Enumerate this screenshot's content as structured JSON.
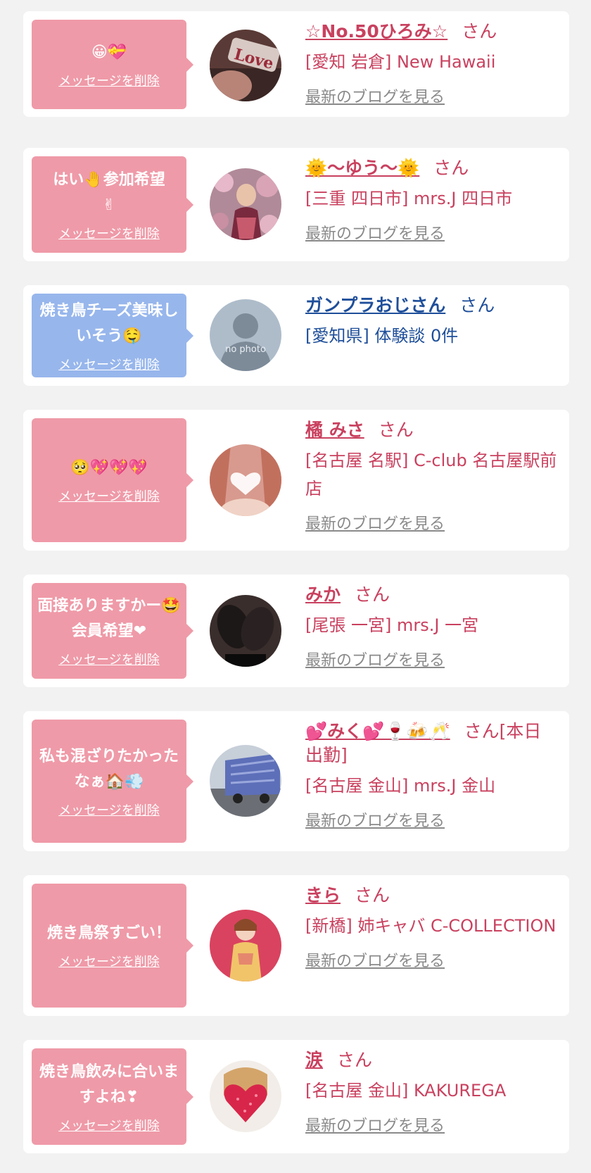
{
  "colors": {
    "card_bg": "#ffffff",
    "page_bg": "#f2f2f2",
    "bubble_pink": "#ef9aa8",
    "bubble_blue": "#97b6ec",
    "text_pink": "#c9415f",
    "text_blue": "#1f4f9a",
    "link_gray": "#8a8a8a"
  },
  "delete_label": "メッセージを削除",
  "blog_label": "最新のブログを見る",
  "san_suffix": "さん",
  "messages": [
    {
      "message": "😀💝",
      "name": "☆No.50ひろみ☆",
      "shop": "[愛知 岩倉] New Hawaii",
      "avatar": "photo-love-sign",
      "show_blog": true
    },
    {
      "message": "はい🤚参加希望\n✌",
      "name": "🌞〜ゆう〜🌞",
      "shop": "[三重 四日市] mrs.J 四日市",
      "avatar": "photo-kimono-flowers",
      "show_blog": true
    },
    {
      "message": "焼き鳥チーズ美味しいそう🤤",
      "name": "ガンプラおじさん",
      "shop": "[愛知県] 体験談 0件",
      "avatar": "no-photo-silhouette",
      "no_photo_text": "no photo",
      "show_blog": false
    },
    {
      "message": "🥺💖💖💖",
      "name": "橘 みさ",
      "shop": "[名古屋 名駅] C-club 名古屋駅前店",
      "avatar": "photo-heart-face",
      "show_blog": true
    },
    {
      "message": "面接ありますかー🤩会員希望❤",
      "name": "みか",
      "shop": "[尾張 一宮] mrs.J 一宮",
      "avatar": "photo-stockings",
      "show_blog": true
    },
    {
      "message": "私も混ざりたかったなぁ🏠💨",
      "name": "💕みく💕🍷🍻🥂",
      "name_suffix": "さん[本日出勤]",
      "shop": "[名古屋 金山] mrs.J 金山",
      "avatar": "photo-truck",
      "show_blog": true
    },
    {
      "message": "焼き鳥祭すごい！",
      "name": "きら",
      "shop": "[新橋] 姉キャバ C-COLLECTION",
      "avatar": "photo-kimono-red",
      "show_blog": true
    },
    {
      "message": "焼き鳥飲みに合いますよね❣",
      "name": "涙",
      "shop": "[名古屋 金山] KAKUREGA",
      "avatar": "photo-glitter-heart",
      "show_blog": true
    }
  ]
}
